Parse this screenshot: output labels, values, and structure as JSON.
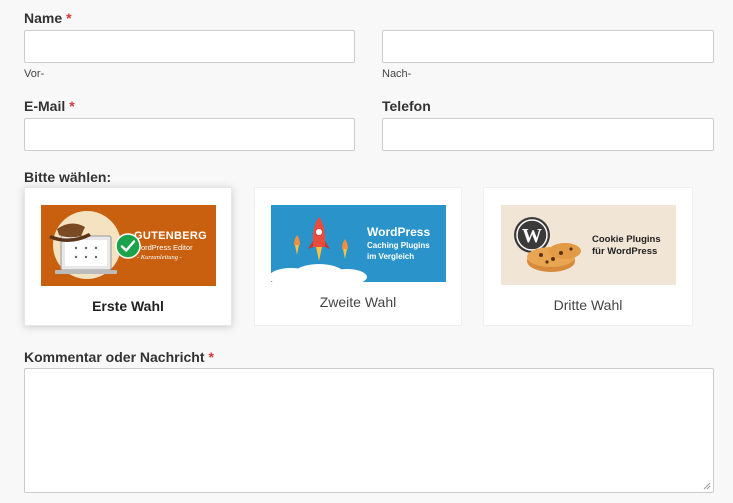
{
  "form": {
    "name": {
      "label": "Name",
      "required_mark": "*",
      "first_sublabel": "Vor-",
      "last_sublabel": "Nach-",
      "first_value": "",
      "last_value": ""
    },
    "email": {
      "label": "E-Mail",
      "required_mark": "*",
      "value": ""
    },
    "phone": {
      "label": "Telefon",
      "value": ""
    },
    "choice": {
      "label": "Bitte wählen:",
      "options": [
        {
          "caption": "Erste Wahl",
          "selected": true,
          "image_lines": [
            "GUTENBERG",
            "WordPress Editor",
            "- Kurzanleitung -"
          ]
        },
        {
          "caption": "Zweite Wahl",
          "selected": false,
          "image_lines": [
            "WordPress",
            "Caching Plugins",
            "im Vergleich"
          ]
        },
        {
          "caption": "Dritte Wahl",
          "selected": false,
          "image_lines": [
            "Cookie Plugins",
            "für WordPress"
          ]
        }
      ]
    },
    "comment": {
      "label": "Kommentar oder Nachricht",
      "required_mark": "*",
      "value": ""
    }
  },
  "colors": {
    "required": "#d63637",
    "gutenberg_bg": "#c9600f",
    "caching_bg": "#2a93c9",
    "cookie_bg": "#f1e5d6",
    "check_green": "#1aa34a"
  },
  "icons": {
    "selected_check": "check-circle-icon",
    "textarea_resize": "resize-grip-icon"
  }
}
